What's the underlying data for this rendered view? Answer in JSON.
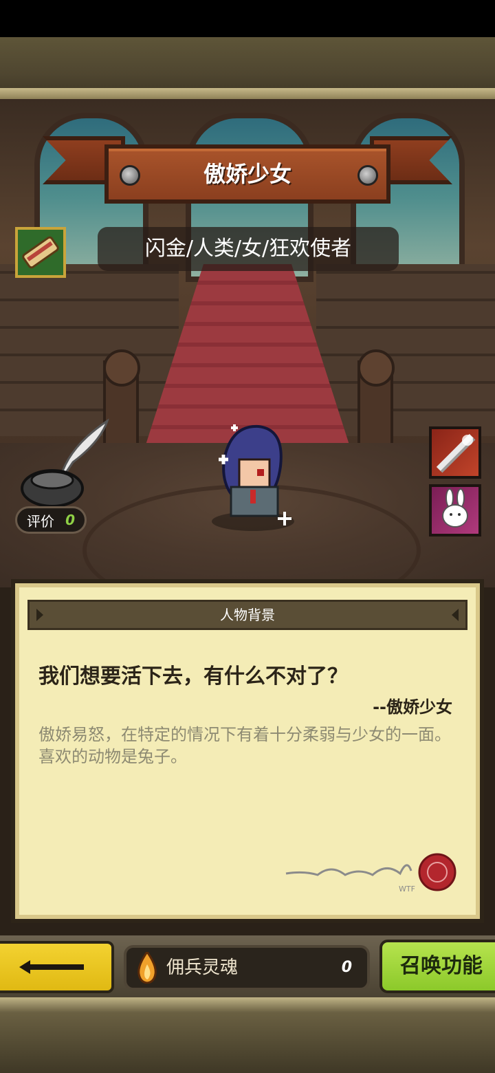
{
  "character": {
    "name": "傲娇少女",
    "tags": "闪金/人类/女/狂欢使者",
    "rating_label": "评价",
    "rating_value": "0"
  },
  "background_panel": {
    "header": "人物背景",
    "quote": "我们想要活下去，有什么不对了？",
    "quote_author": "--傲娇少女",
    "description": "傲娇易怒，在特定的情况下有着十分柔弱与少女的一面。喜欢的动物是兔子。",
    "signature_small_text": "WTF"
  },
  "bottom_bar": {
    "soul_label": "佣兵灵魂",
    "soul_count": "0",
    "summon_label": "召唤功能"
  },
  "icons": {
    "scroll_badge": "scroll-icon",
    "inkwell": "quill-inkwell-icon",
    "skill_1": "crossed-swords-skill-icon",
    "skill_2": "rabbit-skill-icon",
    "soul": "soul-flame-icon",
    "back": "back-arrow-icon"
  }
}
